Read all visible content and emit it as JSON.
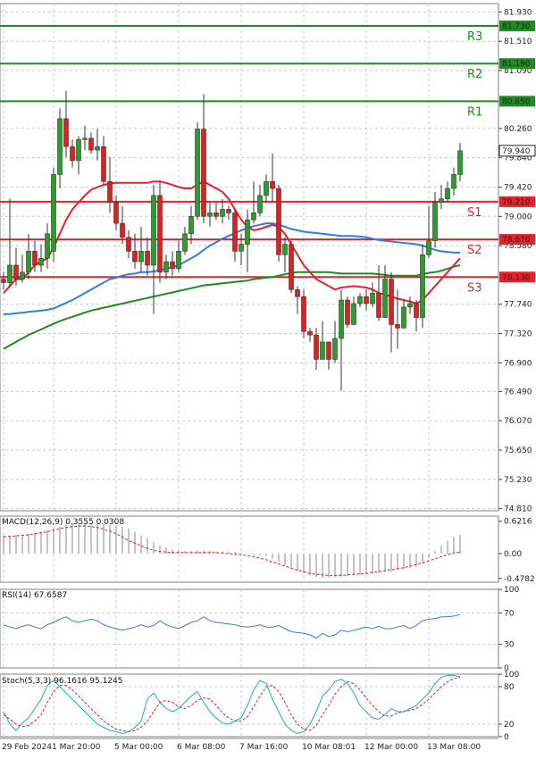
{
  "chart_data": {
    "type": "candlestick",
    "main": {
      "y_ticks": [
        "81.930",
        "81.510",
        "81.090",
        "80.260",
        "79.840",
        "79.420",
        "79.000",
        "78.580",
        "77.740",
        "77.320",
        "76.900",
        "76.490",
        "76.070",
        "75.650",
        "75.230",
        "74.810"
      ],
      "y_values": [
        81.93,
        81.51,
        81.09,
        80.26,
        79.84,
        79.42,
        79.0,
        78.58,
        77.74,
        77.32,
        76.9,
        76.49,
        76.07,
        75.65,
        75.23,
        74.81
      ],
      "ylim": [
        74.78,
        82.05
      ],
      "last_price": "79.940",
      "last_value": 79.94,
      "levels": [
        {
          "name": "R3",
          "value": 81.73,
          "label": "81.730",
          "color": "#1e8c1e"
        },
        {
          "name": "R2",
          "value": 81.19,
          "label": "81.190",
          "color": "#1e8c1e"
        },
        {
          "name": "R1",
          "value": 80.65,
          "label": "80.650",
          "color": "#1e8c1e"
        },
        {
          "name": "S1",
          "value": 79.21,
          "label": "79.210",
          "color": "#e8202a"
        },
        {
          "name": "S2",
          "value": 78.67,
          "label": "78.670",
          "color": "#e8202a"
        },
        {
          "name": "S3",
          "value": 78.13,
          "label": "78.130",
          "color": "#e8202a"
        }
      ],
      "candles": [
        [
          78.1,
          78.05,
          78.2,
          77.95
        ],
        [
          78.05,
          78.3,
          79.25,
          77.98
        ],
        [
          78.3,
          78.1,
          78.55,
          78.0
        ],
        [
          78.1,
          78.2,
          78.45,
          78.05
        ],
        [
          78.2,
          78.5,
          78.75,
          78.1
        ],
        [
          78.5,
          78.3,
          78.65,
          78.2
        ],
        [
          78.3,
          78.4,
          78.6,
          78.2
        ],
        [
          78.4,
          78.75,
          78.9,
          78.25
        ],
        [
          78.5,
          79.6,
          79.7,
          78.35
        ],
        [
          79.6,
          80.4,
          80.55,
          79.4
        ],
        [
          80.4,
          80.0,
          80.8,
          79.85
        ],
        [
          80.0,
          79.8,
          80.1,
          79.7
        ],
        [
          79.8,
          80.1,
          80.15,
          79.6
        ],
        [
          80.1,
          80.12,
          80.3,
          79.95
        ],
        [
          80.12,
          79.95,
          80.2,
          79.9
        ],
        [
          79.95,
          80.0,
          80.25,
          79.8
        ],
        [
          80.0,
          79.5,
          80.15,
          79.45
        ],
        [
          79.5,
          79.2,
          79.85,
          79.05
        ],
        [
          79.2,
          78.9,
          79.3,
          78.8
        ],
        [
          78.9,
          78.7,
          79.15,
          78.6
        ],
        [
          78.7,
          78.5,
          78.8,
          78.4
        ],
        [
          78.5,
          78.35,
          78.75,
          78.25
        ],
        [
          78.35,
          78.5,
          78.85,
          78.2
        ],
        [
          78.5,
          78.3,
          78.7,
          78.15
        ],
        [
          78.3,
          79.3,
          79.45,
          77.6
        ],
        [
          79.3,
          78.2,
          79.5,
          78.05
        ],
        [
          78.2,
          78.35,
          78.45,
          78.1
        ],
        [
          78.35,
          78.25,
          78.5,
          78.15
        ],
        [
          78.25,
          78.5,
          78.65,
          78.2
        ],
        [
          78.5,
          78.75,
          78.85,
          78.45
        ],
        [
          78.75,
          79.0,
          79.15,
          78.6
        ],
        [
          79.0,
          80.25,
          80.35,
          78.95
        ],
        [
          80.25,
          79.0,
          80.75,
          78.9
        ],
        [
          79.0,
          79.05,
          79.2,
          78.85
        ],
        [
          79.05,
          79.0,
          79.2,
          78.95
        ],
        [
          79.0,
          79.1,
          79.25,
          78.9
        ],
        [
          79.1,
          79.05,
          79.15,
          78.95
        ],
        [
          79.05,
          78.5,
          79.1,
          78.35
        ],
        [
          78.5,
          78.6,
          78.75,
          78.3
        ],
        [
          78.6,
          78.95,
          79.1,
          78.2
        ],
        [
          78.95,
          79.05,
          79.5,
          78.9
        ],
        [
          79.05,
          79.3,
          79.45,
          79.0
        ],
        [
          79.3,
          79.5,
          79.6,
          79.2
        ],
        [
          79.5,
          79.4,
          79.9,
          79.2
        ],
        [
          79.4,
          78.45,
          79.45,
          78.35
        ],
        [
          78.45,
          78.6,
          78.7,
          78.2
        ],
        [
          78.6,
          77.95,
          78.65,
          77.9
        ],
        [
          77.95,
          77.85,
          78.0,
          77.6
        ],
        [
          77.85,
          77.35,
          77.95,
          77.25
        ],
        [
          77.35,
          77.3,
          77.4,
          77.2
        ],
        [
          77.3,
          76.95,
          77.4,
          76.8
        ],
        [
          76.95,
          77.2,
          77.5,
          76.95
        ],
        [
          77.2,
          76.95,
          77.1,
          76.8
        ],
        [
          76.95,
          77.25,
          77.5,
          76.9
        ],
        [
          77.25,
          77.8,
          77.95,
          76.5
        ],
        [
          77.8,
          77.45,
          77.85,
          77.4
        ],
        [
          77.45,
          77.75,
          77.85,
          77.45
        ],
        [
          77.75,
          77.85,
          77.9,
          77.7
        ],
        [
          77.85,
          77.75,
          77.95,
          77.65
        ],
        [
          77.75,
          77.9,
          78.05,
          77.7
        ],
        [
          77.9,
          77.55,
          78.3,
          77.5
        ],
        [
          77.55,
          78.1,
          78.3,
          77.55
        ],
        [
          78.1,
          77.45,
          78.2,
          77.05
        ],
        [
          77.45,
          77.4,
          77.95,
          77.1
        ],
        [
          77.4,
          77.7,
          77.8,
          77.45
        ],
        [
          77.7,
          77.75,
          77.85,
          77.6
        ],
        [
          77.75,
          77.55,
          77.8,
          77.35
        ],
        [
          77.55,
          78.45,
          78.6,
          77.4
        ],
        [
          78.45,
          78.65,
          79.15,
          78.4
        ],
        [
          78.65,
          79.2,
          79.35,
          78.55
        ],
        [
          79.2,
          79.25,
          79.45,
          79.1
        ],
        [
          79.25,
          79.4,
          79.5,
          79.2
        ],
        [
          79.4,
          79.6,
          79.7,
          79.3
        ],
        [
          79.6,
          79.94,
          80.05,
          79.5
        ]
      ],
      "ma_red": [
        77.9,
        78.0,
        78.1,
        78.1,
        78.2,
        78.3,
        78.35,
        78.4,
        78.55,
        78.75,
        78.95,
        79.1,
        79.2,
        79.3,
        79.38,
        79.42,
        79.45,
        79.47,
        79.48,
        79.48,
        79.48,
        79.48,
        79.48,
        79.48,
        79.5,
        79.5,
        79.48,
        79.45,
        79.42,
        79.4,
        79.4,
        79.45,
        79.5,
        79.45,
        79.4,
        79.35,
        79.25,
        79.1,
        78.95,
        78.85,
        78.8,
        78.82,
        78.85,
        78.88,
        78.85,
        78.75,
        78.6,
        78.45,
        78.3,
        78.2,
        78.1,
        78.05,
        78.0,
        77.95,
        77.98,
        77.99,
        78.0,
        77.99,
        77.98,
        77.95,
        77.9,
        77.88,
        77.85,
        77.82,
        77.8,
        77.78,
        77.75,
        77.8,
        77.9,
        78.0,
        78.1,
        78.2,
        78.3,
        78.4
      ],
      "ma_blue": [
        77.6,
        77.6,
        77.61,
        77.62,
        77.63,
        77.64,
        77.65,
        77.66,
        77.68,
        77.72,
        77.76,
        77.8,
        77.85,
        77.9,
        77.95,
        78.0,
        78.05,
        78.1,
        78.12,
        78.15,
        78.17,
        78.18,
        78.2,
        78.2,
        78.21,
        78.23,
        78.25,
        78.27,
        78.3,
        78.35,
        78.4,
        78.45,
        78.52,
        78.58,
        78.63,
        78.68,
        78.72,
        78.76,
        78.8,
        78.83,
        78.86,
        78.88,
        78.9,
        78.9,
        78.88,
        78.85,
        78.82,
        78.8,
        78.78,
        78.77,
        78.76,
        78.75,
        78.74,
        78.73,
        78.72,
        78.72,
        78.72,
        78.71,
        78.7,
        78.68,
        78.66,
        78.65,
        78.64,
        78.63,
        78.62,
        78.61,
        78.6,
        78.58,
        78.55,
        78.52,
        78.5,
        78.49,
        78.48,
        78.48
      ],
      "ma_green": [
        77.1,
        77.15,
        77.2,
        77.25,
        77.3,
        77.34,
        77.38,
        77.42,
        77.46,
        77.5,
        77.53,
        77.56,
        77.59,
        77.62,
        77.65,
        77.67,
        77.69,
        77.71,
        77.73,
        77.75,
        77.77,
        77.79,
        77.81,
        77.83,
        77.85,
        77.87,
        77.89,
        77.91,
        77.93,
        77.95,
        77.97,
        77.99,
        78.01,
        78.02,
        78.03,
        78.04,
        78.05,
        78.06,
        78.07,
        78.08,
        78.1,
        78.11,
        78.12,
        78.13,
        78.15,
        78.17,
        78.19,
        78.2,
        78.2,
        78.2,
        78.2,
        78.2,
        78.2,
        78.19,
        78.18,
        78.18,
        78.18,
        78.18,
        78.18,
        78.18,
        78.17,
        78.16,
        78.15,
        78.15,
        78.15,
        78.15,
        78.15,
        78.17,
        78.19,
        78.2,
        78.22,
        78.25,
        78.28,
        78.3
      ]
    },
    "macd": {
      "label": "MACD(12,26,9) 0.3555 0.0308",
      "y_ticks": [
        "0.6216",
        "0.00",
        "-0.4782"
      ],
      "y_values": [
        0.6216,
        0.0,
        -0.4782
      ],
      "ylim": [
        -0.55,
        0.72
      ],
      "histogram": [
        0.35,
        0.35,
        0.36,
        0.37,
        0.38,
        0.4,
        0.42,
        0.45,
        0.48,
        0.52,
        0.56,
        0.58,
        0.58,
        0.58,
        0.58,
        0.58,
        0.57,
        0.56,
        0.54,
        0.52,
        0.48,
        0.42,
        0.35,
        0.3,
        0.22,
        0.16,
        0.12,
        0.08,
        0.06,
        0.05,
        0.05,
        0.06,
        0.06,
        0.05,
        0.04,
        0.04,
        0.04,
        0.03,
        0.01,
        0.0,
        -0.02,
        -0.03,
        -0.05,
        -0.1,
        -0.16,
        -0.22,
        -0.28,
        -0.33,
        -0.38,
        -0.42,
        -0.45,
        -0.46,
        -0.46,
        -0.45,
        -0.44,
        -0.43,
        -0.42,
        -0.41,
        -0.4,
        -0.39,
        -0.37,
        -0.35,
        -0.34,
        -0.32,
        -0.3,
        -0.28,
        -0.25,
        -0.18,
        -0.08,
        0.05,
        0.15,
        0.25,
        0.32,
        0.36
      ],
      "signal": [
        0.32,
        0.33,
        0.34,
        0.35,
        0.36,
        0.38,
        0.4,
        0.42,
        0.45,
        0.48,
        0.5,
        0.52,
        0.53,
        0.53,
        0.52,
        0.5,
        0.47,
        0.43,
        0.38,
        0.32,
        0.25,
        0.2,
        0.15,
        0.1,
        0.06,
        0.04,
        0.03,
        0.02,
        0.02,
        0.02,
        0.02,
        0.02,
        0.02,
        0.02,
        0.02,
        0.01,
        0.0,
        -0.01,
        -0.02,
        -0.04,
        -0.06,
        -0.09,
        -0.12,
        -0.16,
        -0.2,
        -0.24,
        -0.28,
        -0.32,
        -0.35,
        -0.38,
        -0.4,
        -0.41,
        -0.42,
        -0.42,
        -0.42,
        -0.41,
        -0.4,
        -0.39,
        -0.38,
        -0.36,
        -0.35,
        -0.33,
        -0.31,
        -0.29,
        -0.27,
        -0.24,
        -0.21,
        -0.18,
        -0.14,
        -0.1,
        -0.06,
        -0.02,
        0.01,
        0.03
      ]
    },
    "rsi": {
      "label": "RSI(14) 67.6587",
      "y_ticks": [
        "100",
        "70",
        "30",
        "0"
      ],
      "y_values": [
        100,
        70,
        30,
        0
      ],
      "ylim": [
        0,
        100
      ],
      "values": [
        55,
        52,
        50,
        53,
        55,
        52,
        50,
        55,
        58,
        62,
        65,
        60,
        58,
        60,
        62,
        60,
        55,
        52,
        50,
        48,
        50,
        52,
        55,
        52,
        54,
        60,
        55,
        52,
        50,
        54,
        58,
        60,
        65,
        60,
        58,
        57,
        56,
        55,
        53,
        52,
        53,
        55,
        52,
        52,
        54,
        50,
        46,
        45,
        44,
        42,
        38,
        44,
        40,
        42,
        48,
        46,
        48,
        50,
        52,
        50,
        53,
        50,
        50,
        52,
        54,
        50,
        54,
        60,
        62,
        63,
        65,
        65,
        66,
        68
      ]
    },
    "stoch": {
      "label": "Stoch(5,3,3) 96.1616 95.1245",
      "y_ticks": [
        "100",
        "80",
        "20",
        "0"
      ],
      "y_values": [
        100,
        80,
        20,
        0
      ],
      "ylim": [
        0,
        100
      ],
      "k": [
        40,
        20,
        10,
        22,
        30,
        45,
        60,
        82,
        90,
        80,
        70,
        60,
        50,
        40,
        30,
        20,
        15,
        10,
        8,
        5,
        8,
        15,
        25,
        60,
        70,
        55,
        45,
        40,
        45,
        55,
        65,
        72,
        55,
        40,
        30,
        22,
        20,
        25,
        30,
        50,
        75,
        90,
        85,
        60,
        40,
        20,
        10,
        5,
        8,
        20,
        40,
        65,
        75,
        88,
        92,
        85,
        70,
        50,
        40,
        30,
        28,
        35,
        45,
        40,
        40,
        45,
        50,
        60,
        70,
        85,
        95,
        98,
        98,
        96
      ],
      "d": [
        35,
        28,
        20,
        16,
        18,
        25,
        35,
        55,
        72,
        82,
        82,
        75,
        65,
        55,
        45,
        35,
        25,
        18,
        12,
        10,
        8,
        10,
        15,
        25,
        40,
        55,
        58,
        55,
        48,
        45,
        50,
        58,
        62,
        60,
        50,
        38,
        30,
        25,
        25,
        32,
        48,
        65,
        80,
        82,
        72,
        55,
        35,
        20,
        12,
        10,
        18,
        35,
        50,
        68,
        80,
        88,
        85,
        75,
        62,
        50,
        40,
        33,
        33,
        38,
        40,
        42,
        45,
        52,
        60,
        70,
        80,
        88,
        93,
        95
      ]
    },
    "x_ticks": [
      {
        "label": "29 Feb 2024",
        "i": 0
      },
      {
        "label": "1 Mar 20:00",
        "i": 8
      },
      {
        "label": "5 Mar 00:00",
        "i": 18
      },
      {
        "label": "6 Mar 08:00",
        "i": 28
      },
      {
        "label": "7 Mar 16:00",
        "i": 38
      },
      {
        "label": "10 Mar 08:01",
        "i": 48
      },
      {
        "label": "12 Mar 00:00",
        "i": 58
      },
      {
        "label": "13 Mar 08:00",
        "i": 68
      }
    ]
  },
  "colors": {
    "bull": "#2a9d2a",
    "bear": "#e02020",
    "ma_red": "#e8202a",
    "ma_blue": "#2f7fe0",
    "ma_green": "#1e8c1e",
    "macd_hist": "#b0b0b0",
    "macd_signal": "#e02020",
    "rsi": "#2f7fe0",
    "stoch_k": "#1fb0b0",
    "stoch_d": "#e02020",
    "grid": "#c8c8c8"
  }
}
